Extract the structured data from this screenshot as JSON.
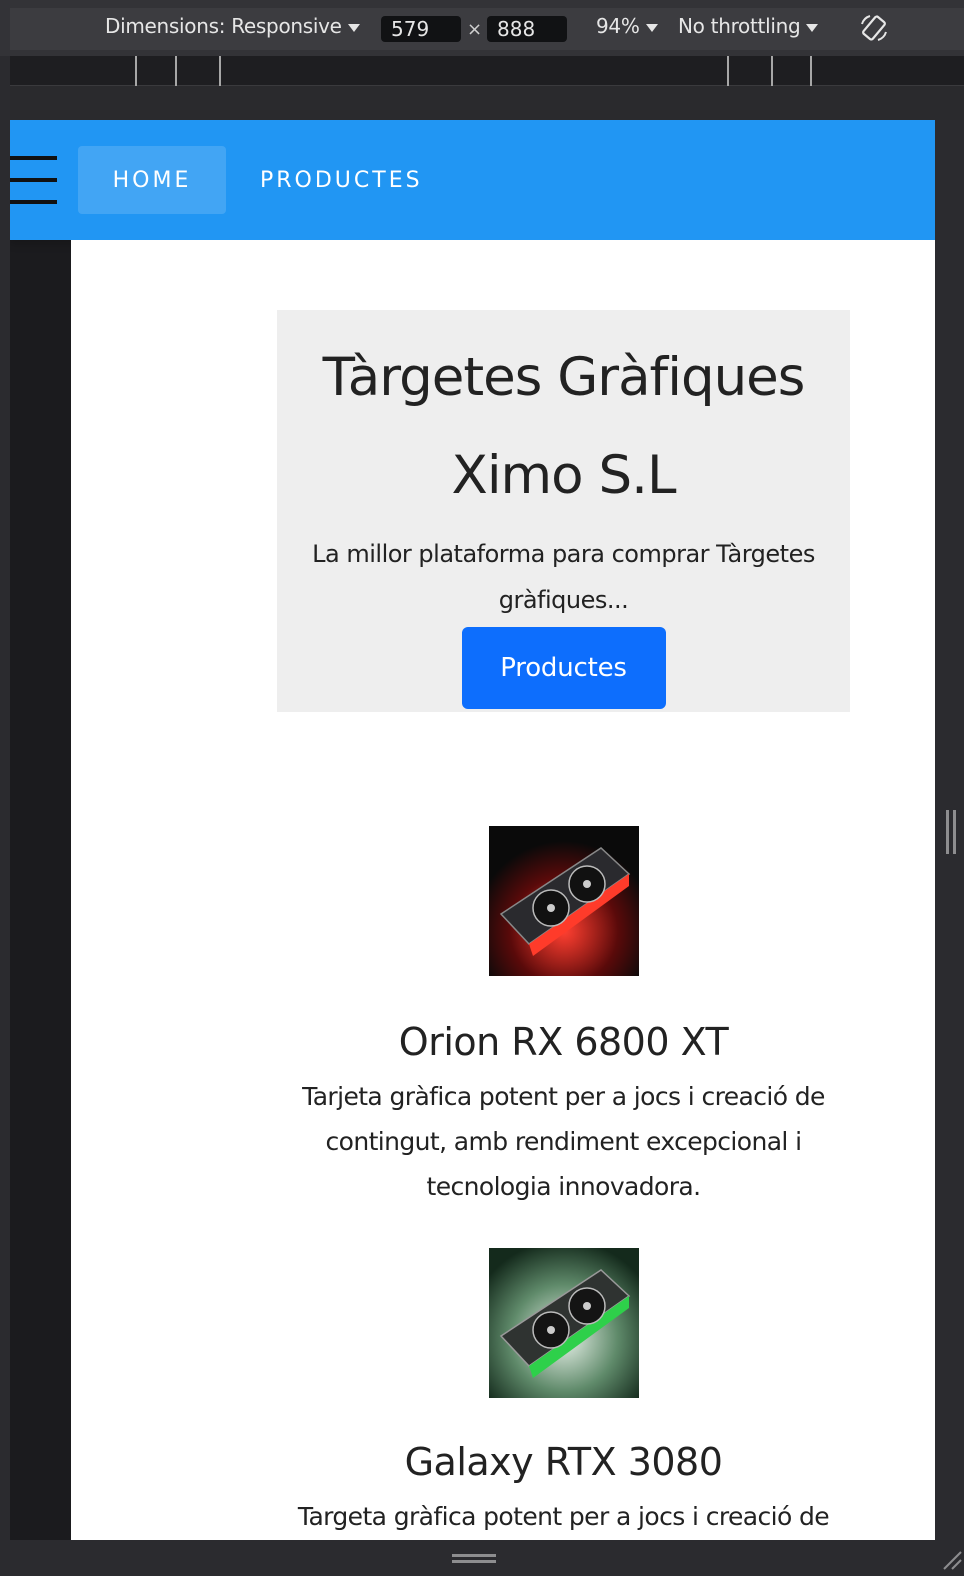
{
  "devtools": {
    "dimensions_label": "Dimensions: Responsive",
    "width_value": "579",
    "times_sign": "×",
    "height_value": "888",
    "zoom_label": "94%",
    "throttling_label": "No throttling"
  },
  "navbar": {
    "home_label": "HOME",
    "products_label": "PRODUCTES",
    "color": "#2196f3"
  },
  "hero": {
    "title": "Tàrgetes Gràfiques Ximo S.L",
    "subtitle": "La millor plataforma para comprar Tàrgetes gràfiques...",
    "button_label": "Productes",
    "button_color": "#0d6efd"
  },
  "products": [
    {
      "name": "Orion RX 6800 XT",
      "description": "Tarjeta gràfica potent per a jocs i creació de contingut, amb rendiment excepcional i tecnologia innovadora.",
      "accent": "#ff2a1a"
    },
    {
      "name": "Galaxy RTX 3080",
      "description": "Targeta gràfica potent per a jocs i creació de",
      "accent": "#2ed04a"
    }
  ]
}
